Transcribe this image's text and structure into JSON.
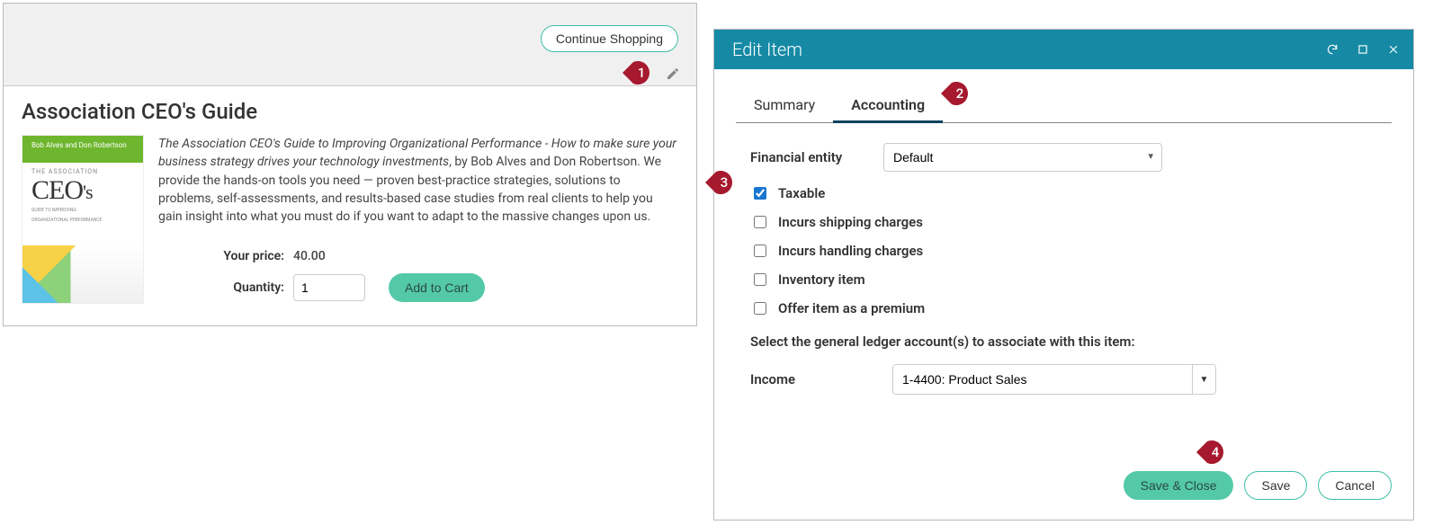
{
  "left": {
    "continue_label": "Continue Shopping",
    "product_title": "Association CEO's Guide",
    "desc_italic": "The Association CEO's Guide to Improving Organizational Performance - How to make sure your business strategy drives your technology investments",
    "desc_rest": ", by Bob Alves and Don Robertson. We provide the hands-on tools you need — proven best-practice strategies, solutions to problems, self-assessments, and results-based case studies from real clients to help you gain insight into what you must do if you want to adapt to the massive changes upon us.",
    "book_topbar": "Bob Alves and Don Robertson",
    "book_label1": "THE ASSOCIATION",
    "book_ceo": "CEO's",
    "book_sub1": "GUIDE TO IMPROVING",
    "book_sub2": "ORGANIZATIONAL PERFORMANCE",
    "price_label": "Your price:",
    "price_value": "40.00",
    "qty_label": "Quantity:",
    "qty_value": "1",
    "add_cart_label": "Add to Cart"
  },
  "modal": {
    "title": "Edit Item",
    "tabs": {
      "summary": "Summary",
      "accounting": "Accounting"
    },
    "financial_label": "Financial entity",
    "financial_value": "Default",
    "checkboxes": {
      "taxable": "Taxable",
      "shipping": "Incurs shipping charges",
      "handling": "Incurs handling charges",
      "inventory": "Inventory item",
      "premium": "Offer item as a premium"
    },
    "ledger_text": "Select the general ledger account(s) to associate with this item:",
    "income_label": "Income",
    "income_value": "1-4400: Product Sales",
    "buttons": {
      "save_close": "Save & Close",
      "save": "Save",
      "cancel": "Cancel"
    }
  },
  "callouts": {
    "c1": "1",
    "c2": "2",
    "c3": "3",
    "c4": "4"
  }
}
